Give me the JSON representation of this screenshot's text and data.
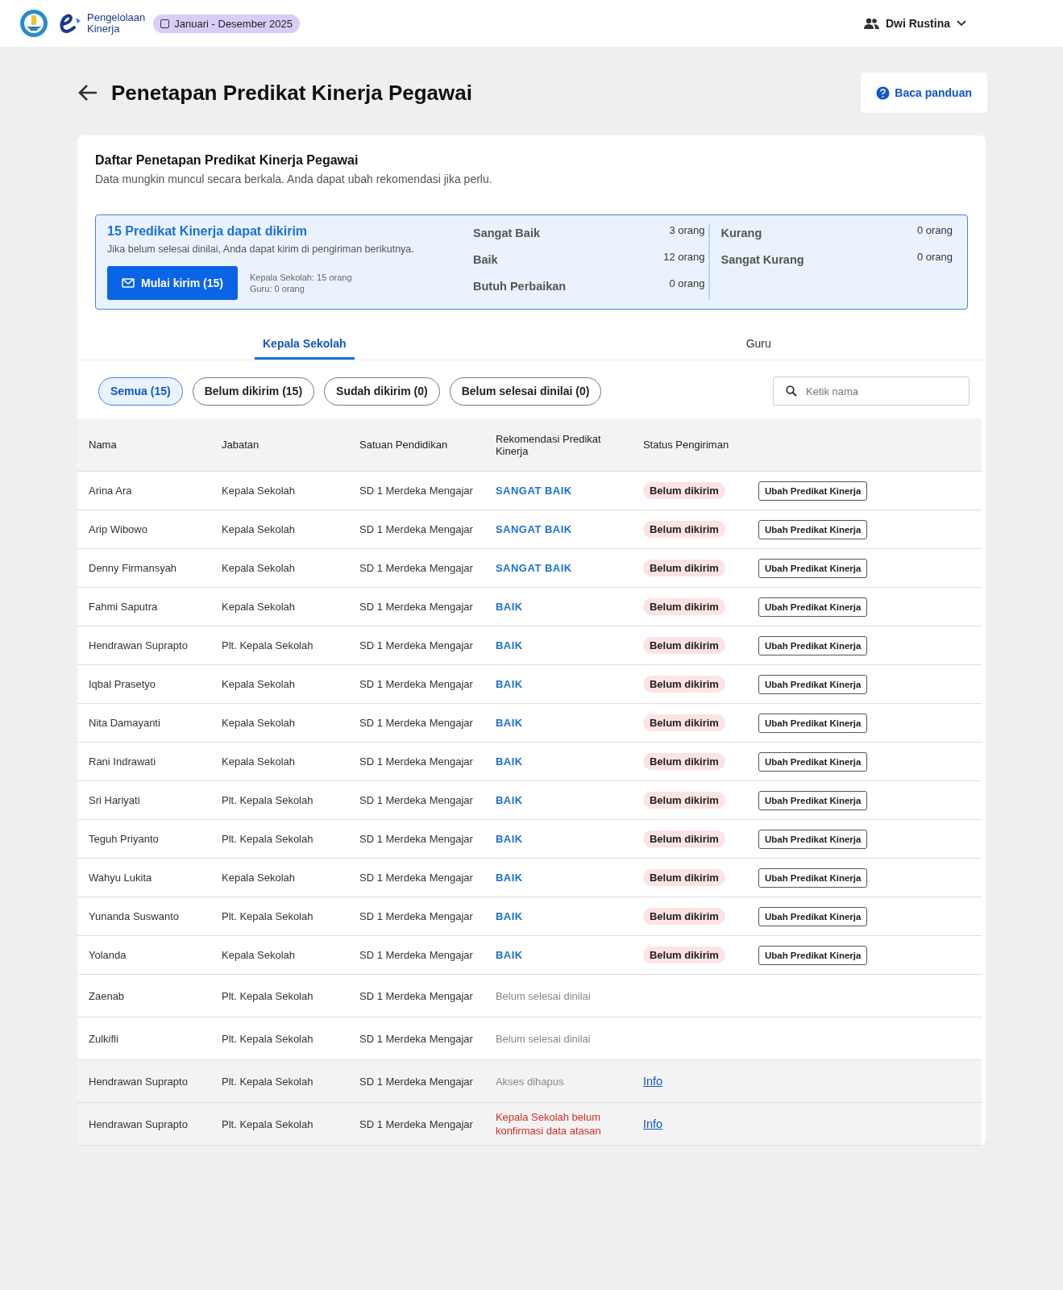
{
  "header": {
    "app_name": [
      "Pengelolaan",
      "Kinerja"
    ],
    "period": "Januari - Desember 2025",
    "user": "Dwi Rustina"
  },
  "page": {
    "title": "Penetapan Predikat Kinerja Pegawai",
    "guide_button": "Baca panduan"
  },
  "card": {
    "title": "Daftar Penetapan Predikat Kinerja Pegawai",
    "subtitle": "Data mungkin muncul secara berkala. Anda dapat ubah rekomendasi jika perlu."
  },
  "summary": {
    "title": "15 Predikat Kinerja dapat dikirim",
    "note": "Jika belum selesai dinilai, Anda dapat kirim di pengiriman berikutnya.",
    "send_button": "Mulai kirim (15)",
    "breakdown": [
      "Kepala Sekolah: 15 orang",
      "Guru: 0 orang"
    ],
    "counts": [
      [
        {
          "label": "Sangat Baik",
          "value": "3 orang"
        },
        {
          "label": "Baik",
          "value": "12 orang"
        },
        {
          "label": "Butuh Perbaikan",
          "value": "0 orang"
        }
      ],
      [
        {
          "label": "Kurang",
          "value": "0 orang"
        },
        {
          "label": "Sangat Kurang",
          "value": "0 orang"
        }
      ]
    ]
  },
  "tabs": [
    {
      "label": "Kepala Sekolah",
      "selected": true
    },
    {
      "label": "Guru",
      "selected": false
    }
  ],
  "filters": [
    {
      "label": "Semua (15)",
      "selected": true
    },
    {
      "label": "Belum dikirim (15)",
      "selected": false
    },
    {
      "label": "Sudah dikirim (0)",
      "selected": false
    },
    {
      "label": "Belum selesai dinilai (0)",
      "selected": false
    }
  ],
  "search": {
    "placeholder": "Ketik nama"
  },
  "table": {
    "columns": [
      "Nama",
      "Jabatan",
      "Satuan Pendidikan",
      "Rekomendasi Predikat Kinerja",
      "Status Pengiriman"
    ],
    "rows": [
      {
        "name": "Arina Ara",
        "position": "Kepala Sekolah",
        "unit": "SD 1 Merdeka Mengajar",
        "recommendation": "SANGAT BAIK",
        "kind": "predicate",
        "status": "Belum dikirim",
        "action": "Ubah Predikat Kinerja",
        "shaded": false
      },
      {
        "name": "Arip Wibowo",
        "position": "Kepala Sekolah",
        "unit": "SD 1 Merdeka Mengajar",
        "recommendation": "SANGAT BAIK",
        "kind": "predicate",
        "status": "Belum dikirim",
        "action": "Ubah Predikat Kinerja",
        "shaded": false
      },
      {
        "name": "Denny Firmansyah",
        "position": "Kepala Sekolah",
        "unit": "SD 1 Merdeka Mengajar",
        "recommendation": "SANGAT BAIK",
        "kind": "predicate",
        "status": "Belum dikirim",
        "action": "Ubah Predikat Kinerja",
        "shaded": false
      },
      {
        "name": "Fahmi Saputra",
        "position": "Kepala Sekolah",
        "unit": "SD 1 Merdeka Mengajar",
        "recommendation": "BAIK",
        "kind": "predicate",
        "status": "Belum dikirim",
        "action": "Ubah Predikat Kinerja",
        "shaded": false
      },
      {
        "name": "Hendrawan Suprapto",
        "position": "Plt. Kepala Sekolah",
        "unit": "SD 1 Merdeka Mengajar",
        "recommendation": "BAIK",
        "kind": "predicate",
        "status": "Belum dikirim",
        "action": "Ubah Predikat Kinerja",
        "shaded": false
      },
      {
        "name": "Iqbal Prasetyo",
        "position": "Kepala Sekolah",
        "unit": "SD 1 Merdeka Mengajar",
        "recommendation": "BAIK",
        "kind": "predicate",
        "status": "Belum dikirim",
        "action": "Ubah Predikat Kinerja",
        "shaded": false
      },
      {
        "name": "Nita Damayanti",
        "position": "Kepala Sekolah",
        "unit": "SD 1 Merdeka Mengajar",
        "recommendation": "BAIK",
        "kind": "predicate",
        "status": "Belum dikirim",
        "action": "Ubah Predikat Kinerja",
        "shaded": false
      },
      {
        "name": "Rani Indrawati",
        "position": "Kepala Sekolah",
        "unit": "SD 1 Merdeka Mengajar",
        "recommendation": "BAIK",
        "kind": "predicate",
        "status": "Belum dikirim",
        "action": "Ubah Predikat Kinerja",
        "shaded": false
      },
      {
        "name": "Sri Hariyati",
        "position": "Plt. Kepala Sekolah",
        "unit": "SD 1 Merdeka Mengajar",
        "recommendation": "BAIK",
        "kind": "predicate",
        "status": "Belum dikirim",
        "action": "Ubah Predikat Kinerja",
        "shaded": false
      },
      {
        "name": "Teguh Priyanto",
        "position": "Plt. Kepala Sekolah",
        "unit": "SD 1 Merdeka Mengajar",
        "recommendation": "BAIK",
        "kind": "predicate",
        "status": "Belum dikirim",
        "action": "Ubah Predikat Kinerja",
        "shaded": false
      },
      {
        "name": "Wahyu Lukita",
        "position": "Kepala Sekolah",
        "unit": "SD 1 Merdeka Mengajar",
        "recommendation": "BAIK",
        "kind": "predicate",
        "status": "Belum dikirim",
        "action": "Ubah Predikat Kinerja",
        "shaded": false
      },
      {
        "name": "Yunanda Suswanto",
        "position": "Plt. Kepala Sekolah",
        "unit": "SD 1 Merdeka Mengajar",
        "recommendation": "BAIK",
        "kind": "predicate",
        "status": "Belum dikirim",
        "action": "Ubah Predikat Kinerja",
        "shaded": false
      },
      {
        "name": "Yolanda",
        "position": "Kepala Sekolah",
        "unit": "SD 1 Merdeka Mengajar",
        "recommendation": "BAIK",
        "kind": "predicate",
        "status": "Belum dikirim",
        "action": "Ubah Predikat Kinerja",
        "shaded": false
      },
      {
        "name": "Zaenab",
        "position": "Plt. Kepala Sekolah",
        "unit": "SD 1 Merdeka Mengajar",
        "recommendation": "Belum selesai dinilai",
        "kind": "pending",
        "shaded": false
      },
      {
        "name": "Zulkifli",
        "position": "Plt. Kepala Sekolah",
        "unit": "SD 1 Merdeka Mengajar",
        "recommendation": "Belum selesai dinilai",
        "kind": "pending",
        "shaded": false
      },
      {
        "name": "Hendrawan Suprapto",
        "position": "Plt. Kepala Sekolah",
        "unit": "SD 1 Merdeka Mengajar",
        "recommendation": "Akses dihapus",
        "kind": "pending",
        "link": "Info",
        "shaded": true
      },
      {
        "name": "Hendrawan Suprapto",
        "position": "Plt. Kepala Sekolah",
        "unit": "SD 1 Merdeka Mengajar",
        "recommendation": "Kepala Sekolah belum konfirmasi data atasan",
        "kind": "error",
        "link": "Info",
        "shaded": true
      }
    ]
  }
}
